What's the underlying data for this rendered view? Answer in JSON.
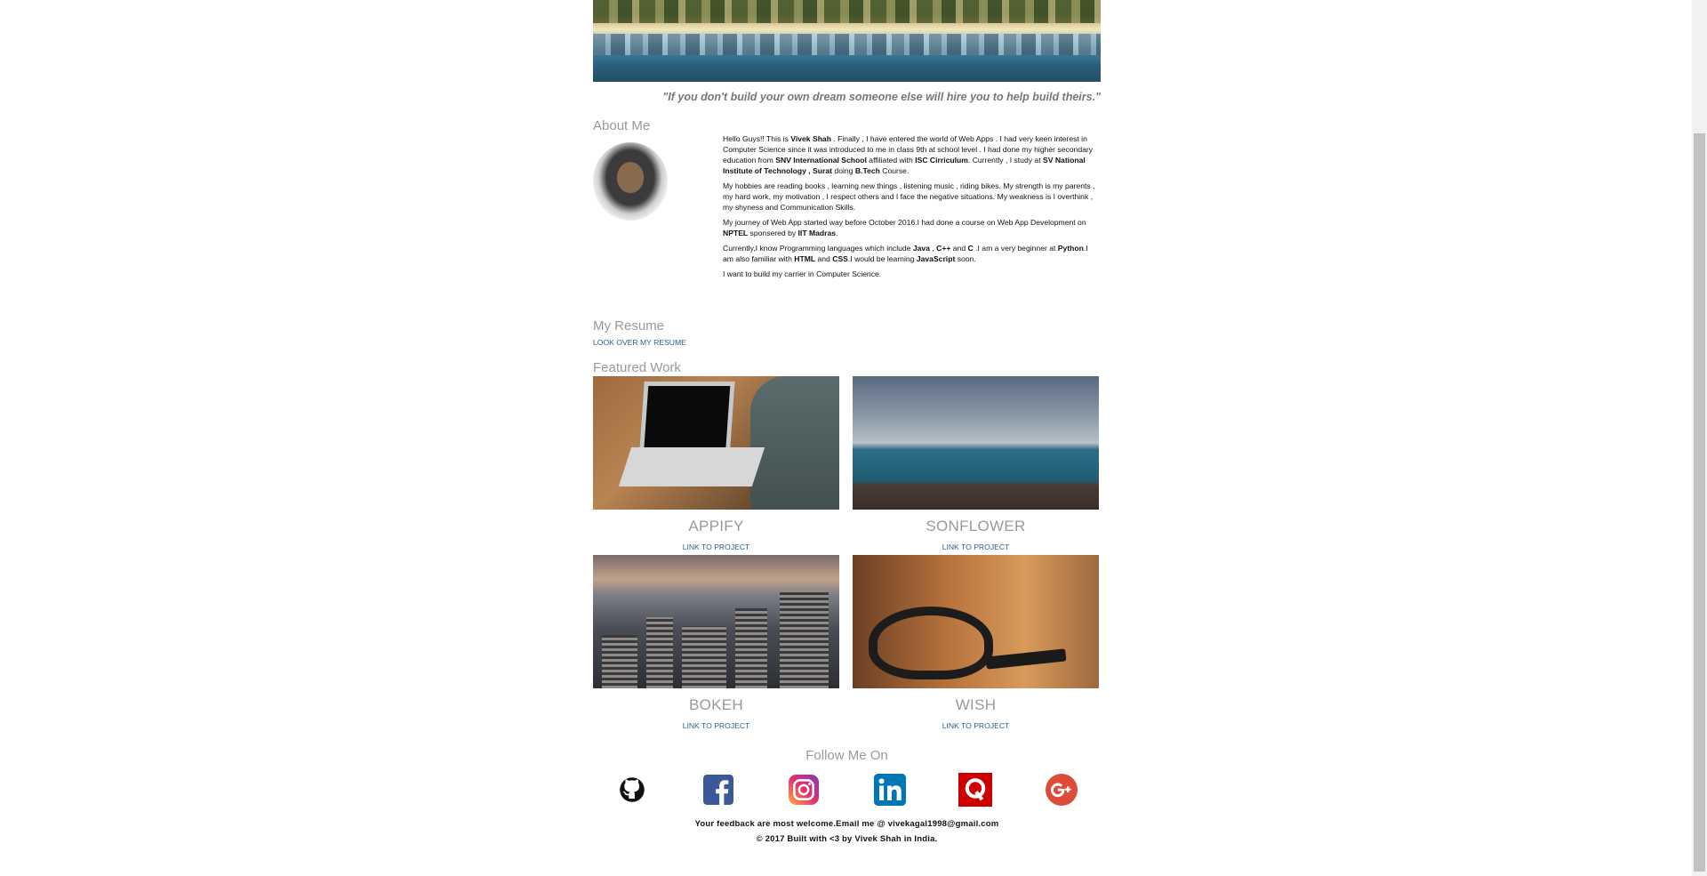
{
  "hero": {
    "quote": "\"If you don't build your own dream someone else will hire you to help build theirs.\""
  },
  "about": {
    "title": "About Me",
    "paragraphs": [
      [
        {
          "t": "Hello Guys!! This is "
        },
        {
          "t": "Vivek Shah",
          "b": true
        },
        {
          "t": " . Finally , I have entered the world of Web Apps . I had very keen interest in Computer Science since it was introduced to me in class 9th at school level . I had done my higher secondary education from "
        },
        {
          "t": "SNV International School",
          "b": true
        },
        {
          "t": " affiliated with "
        },
        {
          "t": "ISC Cirriculum",
          "b": true
        },
        {
          "t": ". Currently , I study at "
        },
        {
          "t": "SV National Institute of Technology , Surat",
          "b": true
        },
        {
          "t": " doing "
        },
        {
          "t": "B.Tech",
          "b": true
        },
        {
          "t": " Course."
        }
      ],
      [
        {
          "t": "My hobbies are reading books , learning new things , listening music , riding bikes. My strength is my parents , my hard work, my motivation , I respect others and I face the negative situations. My weakness is I overthink , my shyness and Communication Skills."
        }
      ],
      [
        {
          "t": "My journey of Web App started way before October 2016.I had done a course on Web App Development on "
        },
        {
          "t": "NPTEL",
          "b": true
        },
        {
          "t": " sponsered by "
        },
        {
          "t": "IIT Madras",
          "b": true
        },
        {
          "t": "."
        }
      ],
      [
        {
          "t": "Currently,I know Programming languages which include "
        },
        {
          "t": "Java",
          "b": true
        },
        {
          "t": " , "
        },
        {
          "t": "C++",
          "b": true
        },
        {
          "t": " and "
        },
        {
          "t": "C",
          "b": true
        },
        {
          "t": " .I am a very beginner at "
        },
        {
          "t": "Python",
          "b": true
        },
        {
          "t": ".I am also familiar with "
        },
        {
          "t": "HTML",
          "b": true
        },
        {
          "t": " and "
        },
        {
          "t": "CSS",
          "b": true
        },
        {
          "t": ".I would be learning "
        },
        {
          "t": "JavaScript",
          "b": true
        },
        {
          "t": " soon."
        }
      ],
      [
        {
          "t": "I want to build my carrier in Computer Science."
        }
      ]
    ]
  },
  "resume": {
    "title": "My Resume",
    "link": "LOOK OVER MY RESUME"
  },
  "featured": {
    "title": "Featured Work",
    "projects": [
      {
        "name": "APPIFY",
        "link": "LINK TO PROJECT"
      },
      {
        "name": "SONFLOWER",
        "link": "LINK TO PROJECT"
      },
      {
        "name": "BOKEH",
        "link": "LINK TO PROJECT"
      },
      {
        "name": "WISH",
        "link": "LINK TO PROJECT"
      }
    ]
  },
  "social": {
    "title": "Follow Me On",
    "icons": [
      "github-icon",
      "facebook-icon",
      "instagram-icon",
      "linkedin-icon",
      "quora-icon",
      "google-plus-icon"
    ],
    "colors": {
      "facebook": "#3b5998",
      "instagram": "#c13584",
      "linkedin": "#0077b5",
      "quora": "#cc0000",
      "google_plus": "#dd4b39"
    }
  },
  "footer": {
    "line1": "Your feedback are most welcome.Email me @ vivekagal1998@gmail.com",
    "line2": "© 2017 Built with <3 by Vivek Shah in India."
  }
}
